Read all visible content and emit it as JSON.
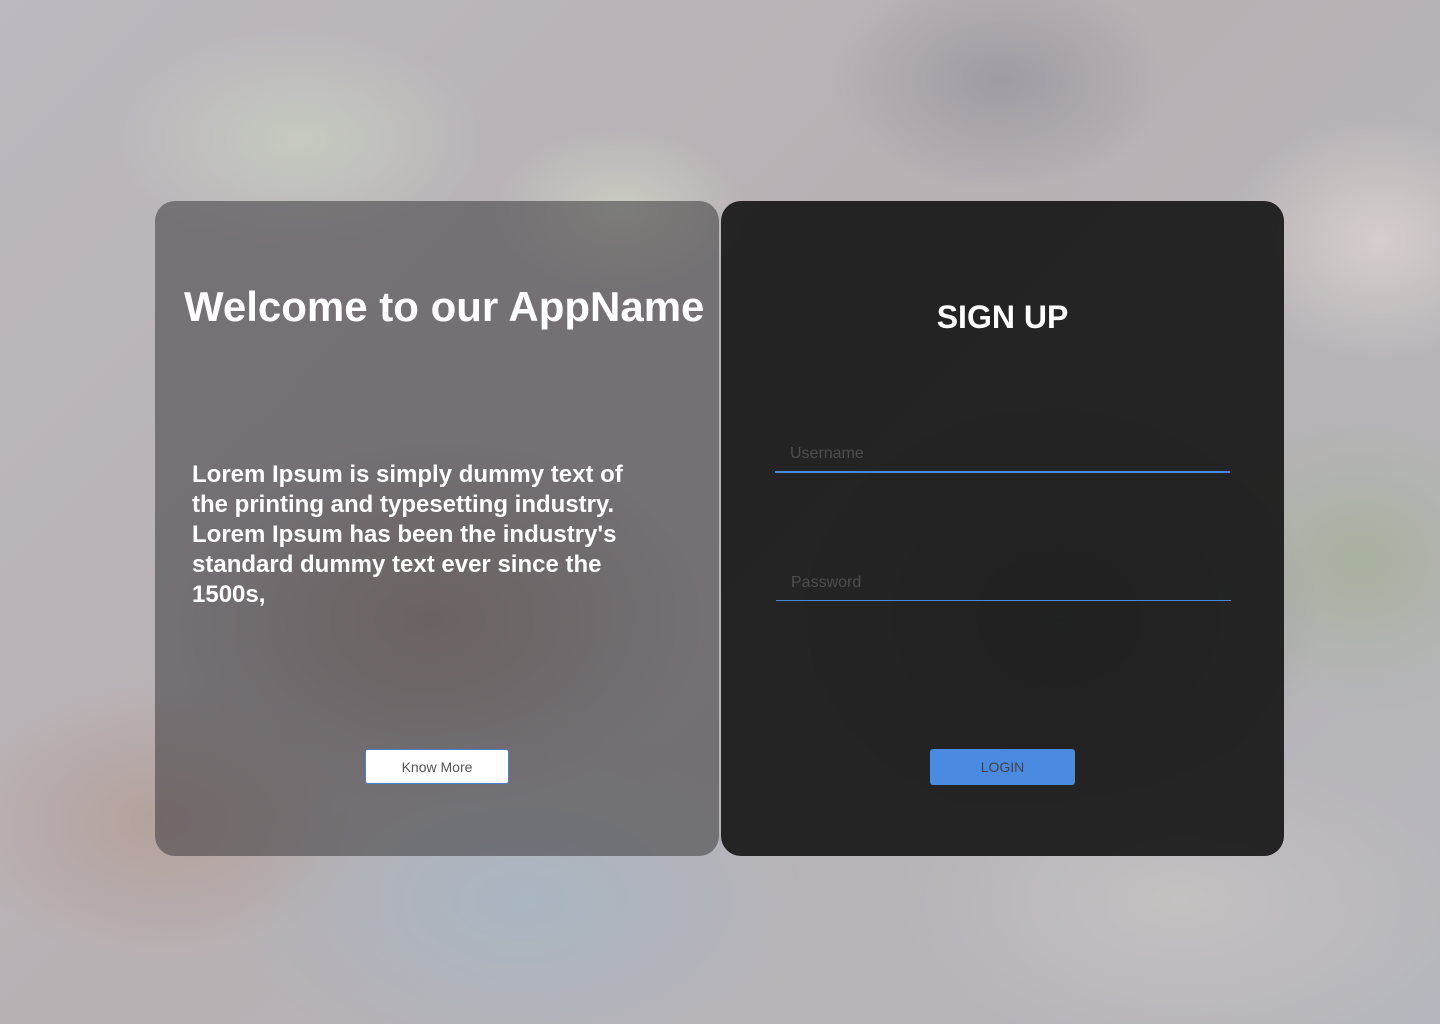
{
  "welcome": {
    "title": "Welcome to our AppName",
    "body": "Lorem Ipsum is simply dummy text of the printing and typesetting industry. Lorem Ipsum has been the industry's standard dummy text ever since the 1500s,",
    "know_more_label": "Know More"
  },
  "signup": {
    "title": "SIGN UP",
    "username_placeholder": "Username",
    "username_value": "",
    "password_placeholder": "Password",
    "password_value": "",
    "login_label": "LOGIN"
  },
  "colors": {
    "accent": "#4a8ae0",
    "left_panel": "rgba(60,58,62,0.55)",
    "right_panel": "#141414"
  }
}
